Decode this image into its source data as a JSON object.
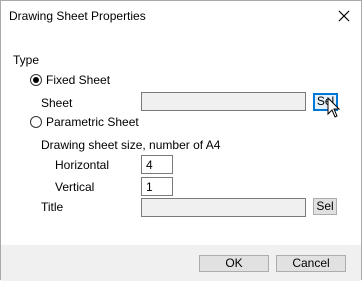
{
  "window": {
    "title": "Drawing Sheet Properties",
    "close_icon": "close-icon"
  },
  "type_group": {
    "label": "Type",
    "fixed_sheet": {
      "label": "Fixed Sheet",
      "selected": true
    },
    "sheet": {
      "label": "Sheet",
      "value": "",
      "button_label": "Sel"
    },
    "parametric_sheet": {
      "label": "Parametric Sheet",
      "selected": false
    },
    "size_label": "Drawing sheet size, number of A4",
    "horizontal": {
      "label": "Horizontal",
      "value": "4"
    },
    "vertical": {
      "label": "Vertical",
      "value": "1"
    },
    "title": {
      "label": "Title",
      "value": "",
      "button_label": "Sel"
    }
  },
  "buttons": {
    "ok": "OK",
    "cancel": "Cancel"
  }
}
